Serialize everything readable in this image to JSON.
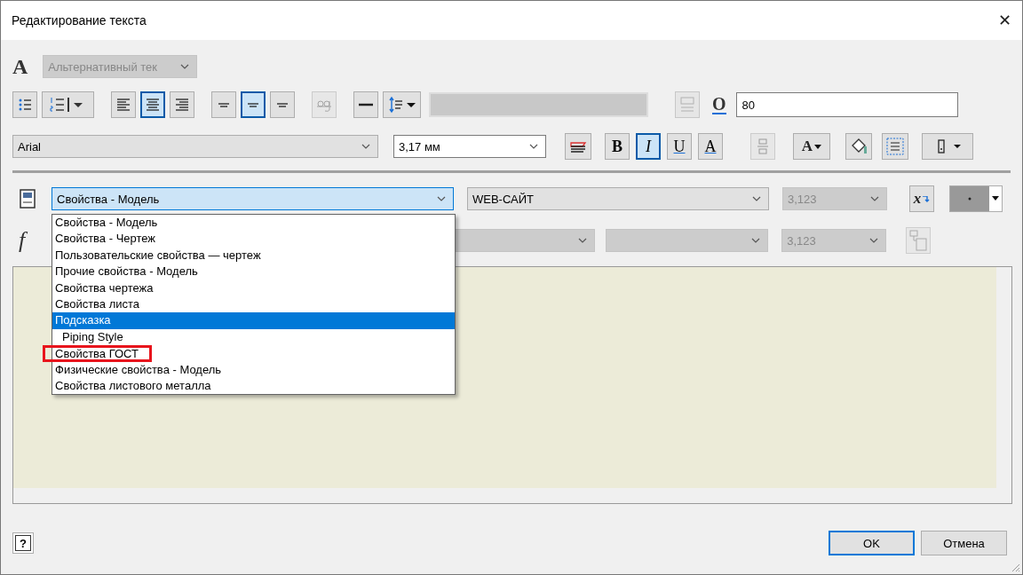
{
  "window": {
    "title": "Редактирование текста",
    "close": "✕"
  },
  "icon_glyphs": {
    "style": "A",
    "width": "O",
    "case": "A",
    "variable": "x",
    "function": "f"
  },
  "help": {
    "label": "?"
  },
  "style_select": {
    "value": "Альтернативный тек",
    "disabled": true
  },
  "format_buttons": [
    {
      "kind": "bullets",
      "selected": false,
      "disabled": false
    },
    {
      "kind": "numbering",
      "selected": false,
      "disabled": false
    },
    {
      "kind": "align-left",
      "selected": false,
      "disabled": false
    },
    {
      "kind": "align-center",
      "selected": true,
      "disabled": false
    },
    {
      "kind": "align-right",
      "selected": false,
      "disabled": false
    },
    {
      "kind": "valign-top",
      "selected": false,
      "disabled": false
    },
    {
      "kind": "valign-middle",
      "selected": true,
      "disabled": false
    },
    {
      "kind": "valign-bottom",
      "selected": false,
      "disabled": false
    },
    {
      "kind": "baseline",
      "selected": false,
      "disabled": true
    },
    {
      "kind": "rule",
      "selected": false,
      "disabled": false
    },
    {
      "kind": "spacing",
      "selected": false,
      "disabled": false
    }
  ],
  "width_field": {
    "value": "80"
  },
  "font": {
    "family": "Arial",
    "size": "3,17 мм"
  },
  "style_buttons": [
    {
      "label": "B",
      "kind": "bold",
      "selected": false
    },
    {
      "label": "I",
      "kind": "italic",
      "selected": true
    },
    {
      "label": "U",
      "kind": "underline",
      "selected": false
    },
    {
      "label": "A",
      "kind": "strike",
      "selected": false
    }
  ],
  "property": {
    "source": "Свойства - Модель",
    "name": "WEB-САЙТ",
    "precision": "3,123",
    "options": [
      {
        "label": "Свойства - Модель",
        "selected": false,
        "highlighted": false,
        "indented": false
      },
      {
        "label": "Свойства - Чертеж",
        "selected": false,
        "highlighted": false,
        "indented": false
      },
      {
        "label": "Пользовательские свойства — чертеж",
        "selected": false,
        "highlighted": false,
        "indented": false
      },
      {
        "label": "Прочие свойства - Модель",
        "selected": false,
        "highlighted": false,
        "indented": false
      },
      {
        "label": "Свойства чертежа",
        "selected": false,
        "highlighted": false,
        "indented": false
      },
      {
        "label": "Свойства листа",
        "selected": false,
        "highlighted": false,
        "indented": false
      },
      {
        "label": "Подсказка",
        "selected": true,
        "highlighted": false,
        "indented": false
      },
      {
        "label": "Piping Style",
        "selected": false,
        "highlighted": false,
        "indented": true
      },
      {
        "label": "Свойства ГОСТ",
        "selected": false,
        "highlighted": true,
        "indented": false
      },
      {
        "label": "Физические свойства - Модель",
        "selected": false,
        "highlighted": false,
        "indented": false
      },
      {
        "label": "Свойства листового металла",
        "selected": false,
        "highlighted": false,
        "indented": false
      }
    ]
  },
  "parameter": {
    "precision": "3,123"
  },
  "buttons": [
    {
      "label": "OK",
      "default": true
    },
    {
      "label": "Отмена",
      "default": false
    }
  ]
}
